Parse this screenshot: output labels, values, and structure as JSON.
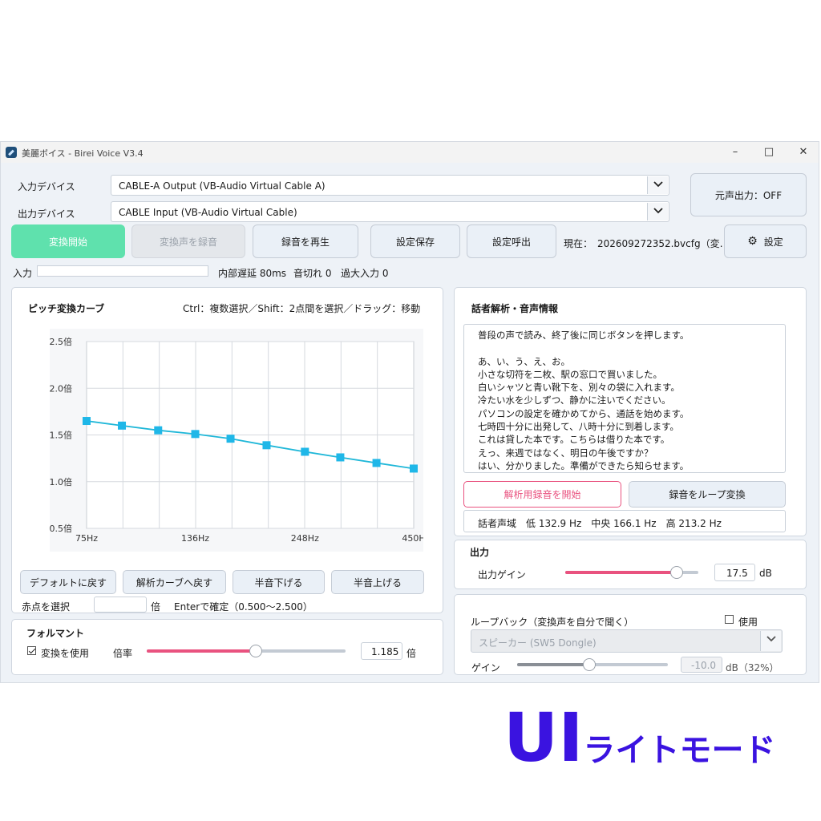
{
  "window": {
    "title": "美麗ボイス - Birei Voice V3.4"
  },
  "devices": {
    "input_label": "入力デバイス",
    "input_value": "CABLE-A Output (VB-Audio Virtual Cable A)",
    "output_label": "出力デバイス",
    "output_value": "CABLE Input (VB-Audio Virtual Cable)",
    "monitor_button": "元声出力：OFF"
  },
  "toolbar": {
    "start": "変換開始",
    "record": "変換声を録音",
    "play": "録音を再生",
    "save": "設定保存",
    "load": "設定呼出",
    "current_label": "現在：",
    "current_file": "202609272352.bvcfg（変…",
    "settings": "設定"
  },
  "status": {
    "input_label": "入力",
    "latency": "内部遅延 80ms",
    "dropouts": "音切れ 0",
    "overload": "過大入力 0"
  },
  "pitch_panel": {
    "title": "ピッチ変換カーブ",
    "hint": "Ctrl：複数選択／Shift：2点間を選択／ドラッグ：移動",
    "buttons": {
      "default": "デフォルトに戻す",
      "to_analysis": "解析カーブへ戻す",
      "semitone_down": "半音下げる",
      "semitone_up": "半音上げる"
    },
    "select_label": "赤点を選択",
    "select_unit": "倍",
    "select_hint": "Enterで確定（0.500～2.500）"
  },
  "chart_data": {
    "type": "line",
    "y_tick_labels": [
      "2.5倍",
      "2.0倍",
      "1.5倍",
      "1.0倍",
      "0.5倍"
    ],
    "x_tick_labels": [
      "75Hz",
      "136Hz",
      "248Hz",
      "450H"
    ],
    "ylim": [
      0.5,
      2.5
    ],
    "xlim": [
      75,
      450
    ],
    "grid": true,
    "x": [
      75,
      91,
      111,
      136,
      165,
      201,
      248,
      301,
      367,
      450
    ],
    "values": [
      1.65,
      1.6,
      1.55,
      1.51,
      1.46,
      1.39,
      1.32,
      1.26,
      1.2,
      1.14
    ],
    "line_color": "#1fb7d8",
    "marker_color": "#1fb7e8"
  },
  "formant_panel": {
    "title": "フォルマント",
    "enable_label": "変換を使用",
    "ratio_label": "倍率",
    "ratio_value": "1.185",
    "ratio_unit": "倍",
    "slider_level": 0.55
  },
  "speaker_panel": {
    "title": "話者解析・音声情報",
    "script_lines": [
      "普段の声で読み、終了後に同じボタンを押します。",
      "",
      "あ、い、う、え、お。",
      "小さな切符を二枚、駅の窓口で買いました。",
      "白いシャツと青い靴下を、別々の袋に入れます。",
      "冷たい水を少しずつ、静かに注いでください。",
      "パソコンの設定を確かめてから、通話を始めます。",
      "七時四十分に出発して、八時十分に到着します。",
      "これは貸した本です。こちらは借りた本です。",
      "えっ、来週ではなく、明日の午後ですか？",
      "はい、分かりました。準備ができたら知らせます。"
    ],
    "start_analysis": "解析用録音を開始",
    "loop_convert": "録音をループ変換",
    "range_text": "話者声域　低 132.9 Hz　中央 166.1 Hz　高 213.2 Hz"
  },
  "output_panel": {
    "title": "出力",
    "gain_label": "出力ゲイン",
    "gain_value": "17.5",
    "gain_unit": "dB",
    "slider_level": 0.84
  },
  "loopback_panel": {
    "title": "ループバック（変換声を自分で聞く）",
    "use_label": "使用",
    "device": "スピーカー (SW5 Dongle)",
    "gain_label": "ゲイン",
    "gain_value": "-10.0",
    "gain_unit": "dB（32%）",
    "slider_level": 0.48
  },
  "branding": {
    "big": "UI",
    "small": "ライトモード"
  }
}
